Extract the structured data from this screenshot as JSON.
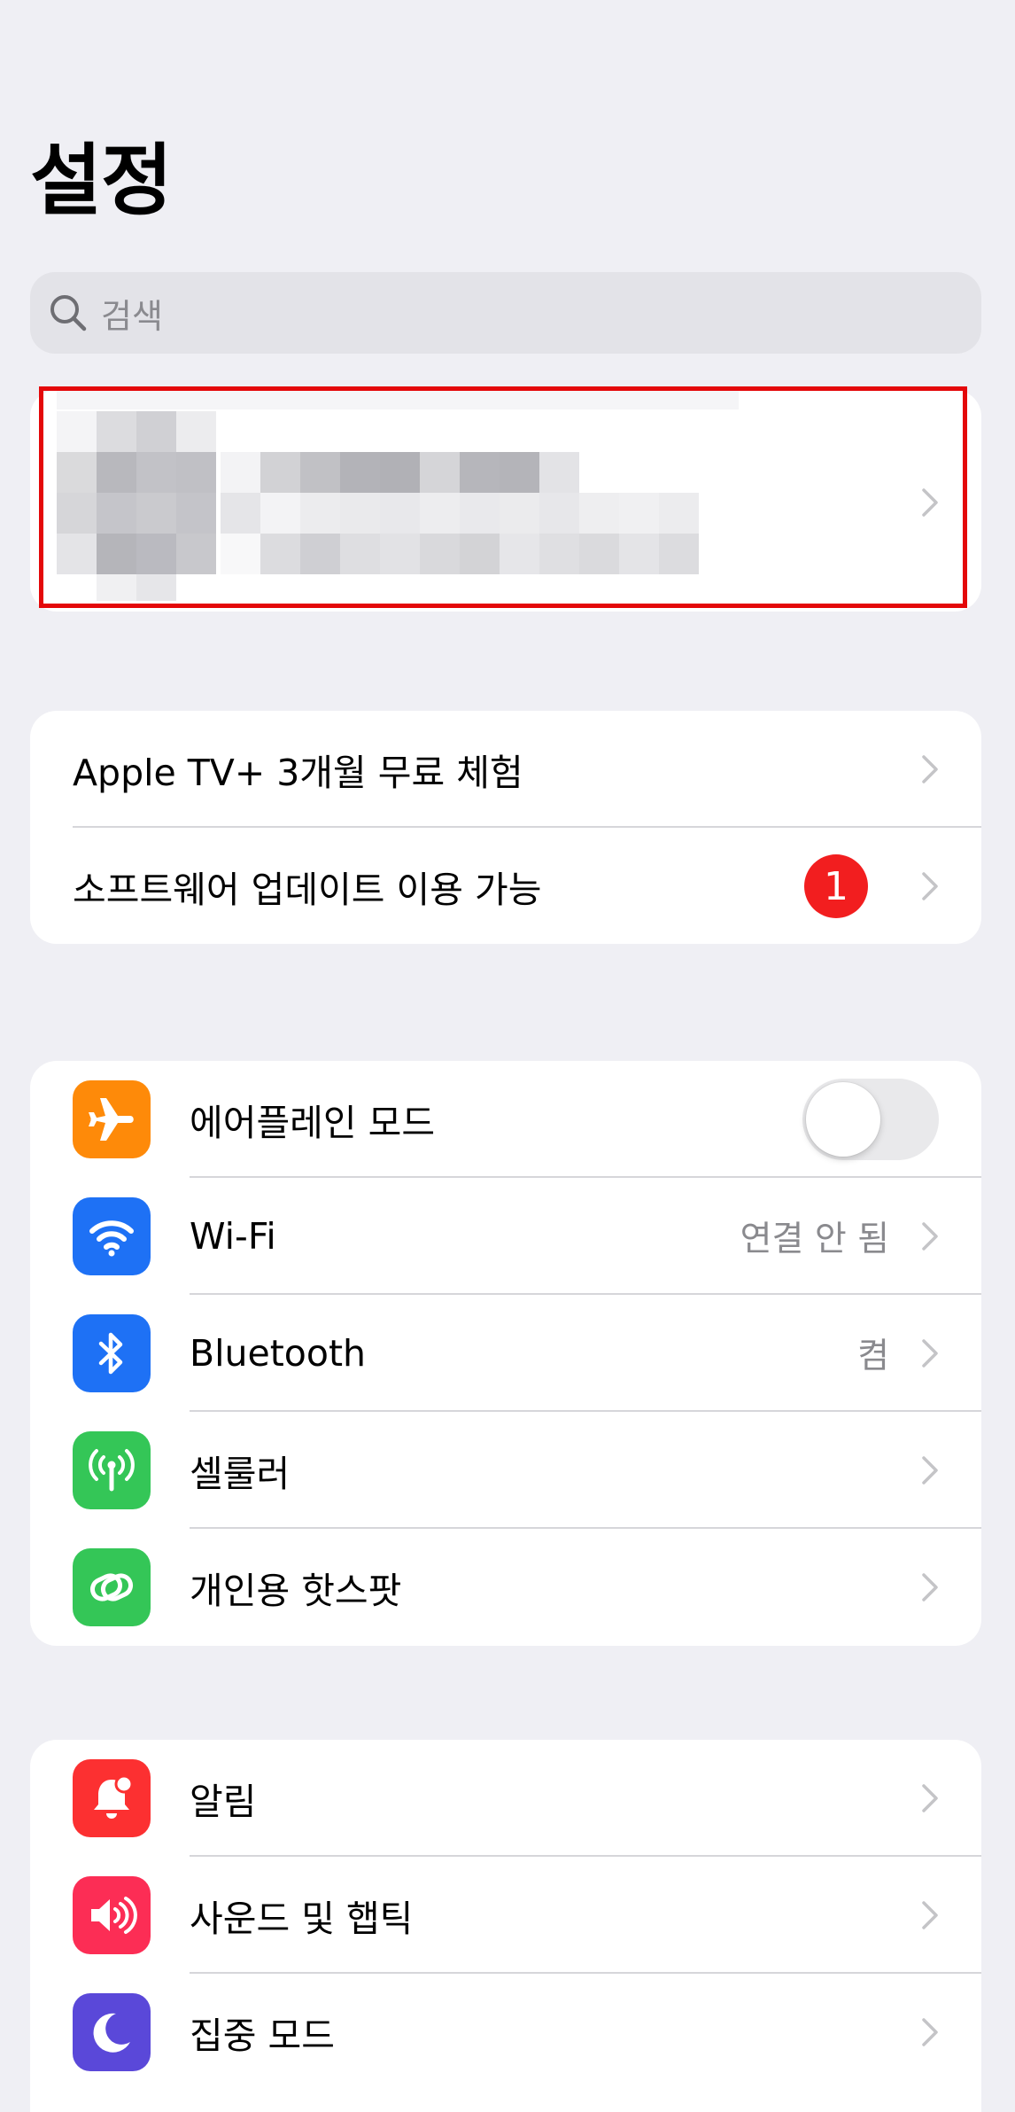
{
  "header": {
    "title": "설정"
  },
  "search": {
    "placeholder": "검색"
  },
  "promo": {
    "items": [
      {
        "label": "Apple TV+ 3개월 무료 체험"
      },
      {
        "label": "소프트웨어 업데이트 이용 가능",
        "badge": "1"
      }
    ]
  },
  "connectivity": {
    "items": [
      {
        "label": "에어플레인 모드",
        "icon": "airplane-icon",
        "color": "#fe8a09",
        "toggle": false
      },
      {
        "label": "Wi-Fi",
        "icon": "wifi-icon",
        "color": "#1e71f5",
        "value": "연결 안 됨"
      },
      {
        "label": "Bluetooth",
        "icon": "bluetooth-icon",
        "color": "#1e71f5",
        "value": "켬"
      },
      {
        "label": "셀룰러",
        "icon": "antenna-icon",
        "color": "#34c657"
      },
      {
        "label": "개인용 핫스팟",
        "icon": "hotspot-link-icon",
        "color": "#34c657"
      }
    ]
  },
  "notifications": {
    "items": [
      {
        "label": "알림",
        "icon": "bell-badge-icon",
        "color": "#fc3031"
      },
      {
        "label": "사운드 및 햅틱",
        "icon": "speaker-icon",
        "color": "#fc2d55"
      },
      {
        "label": "집중 모드",
        "icon": "moon-icon",
        "color": "#5a48d9"
      }
    ]
  },
  "colors": {
    "background": "#efeff4",
    "highlight": "#e4080a",
    "badge": "#f21e1f"
  }
}
